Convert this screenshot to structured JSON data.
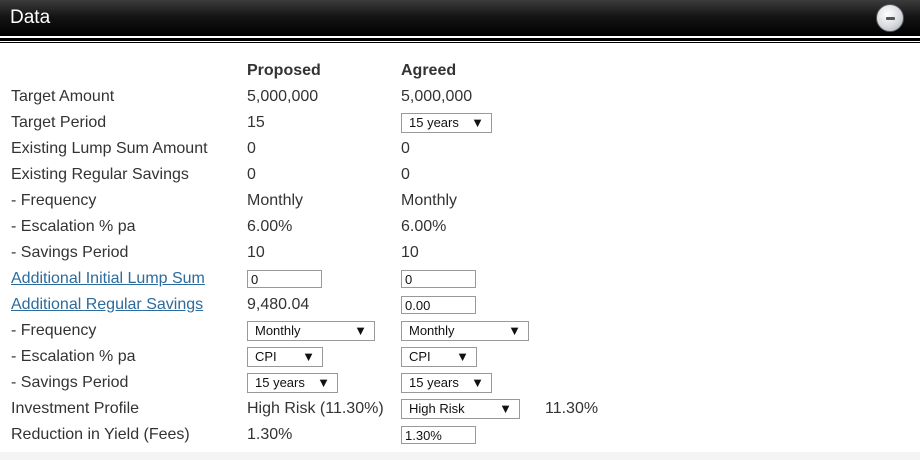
{
  "header": {
    "title": "Data"
  },
  "columns": {
    "proposed": "Proposed",
    "agreed": "Agreed"
  },
  "rows": {
    "target_amount": {
      "label": "Target Amount",
      "proposed": "5,000,000",
      "agreed": "5,000,000"
    },
    "target_period": {
      "label": "Target Period",
      "proposed": "15",
      "agreed": "15 years"
    },
    "existing_lump_sum": {
      "label": "Existing Lump Sum Amount",
      "proposed": "0",
      "agreed": "0"
    },
    "existing_regular_savings": {
      "label": "Existing Regular Savings",
      "proposed": "0",
      "agreed": "0"
    },
    "existing_frequency": {
      "label": "- Frequency",
      "proposed": "Monthly",
      "agreed": "Monthly"
    },
    "existing_escalation": {
      "label": "- Escalation % pa",
      "proposed": "6.00%",
      "agreed": "6.00%"
    },
    "existing_savings_period": {
      "label": "- Savings Period",
      "proposed": "10",
      "agreed": "10"
    },
    "additional_lump_sum": {
      "label": "Additional Initial Lump Sum",
      "proposed": "0",
      "agreed": "0"
    },
    "additional_regular_savings": {
      "label": "Additional Regular Savings",
      "proposed": "9,480.04",
      "agreed": "0.00"
    },
    "additional_frequency": {
      "label": "- Frequency",
      "proposed": "Monthly",
      "agreed": "Monthly"
    },
    "additional_escalation": {
      "label": "- Escalation % pa",
      "proposed": "CPI",
      "agreed": "CPI"
    },
    "additional_savings_period": {
      "label": "- Savings Period",
      "proposed": "15 years",
      "agreed": "15 years"
    },
    "investment_profile": {
      "label": "Investment Profile",
      "proposed": "High Risk (11.30%)",
      "agreed": "High Risk",
      "agreed_rate": "11.30%"
    },
    "reduction_in_yield": {
      "label": "Reduction in Yield (Fees)",
      "proposed": "1.30%",
      "agreed": "1.30%"
    }
  },
  "icons": {
    "collapse": "minus-circle-icon",
    "dropdown": "triangle-down-icon"
  },
  "colors": {
    "header_bg": "#000000",
    "link": "#2b6b9e",
    "text": "#333333"
  }
}
